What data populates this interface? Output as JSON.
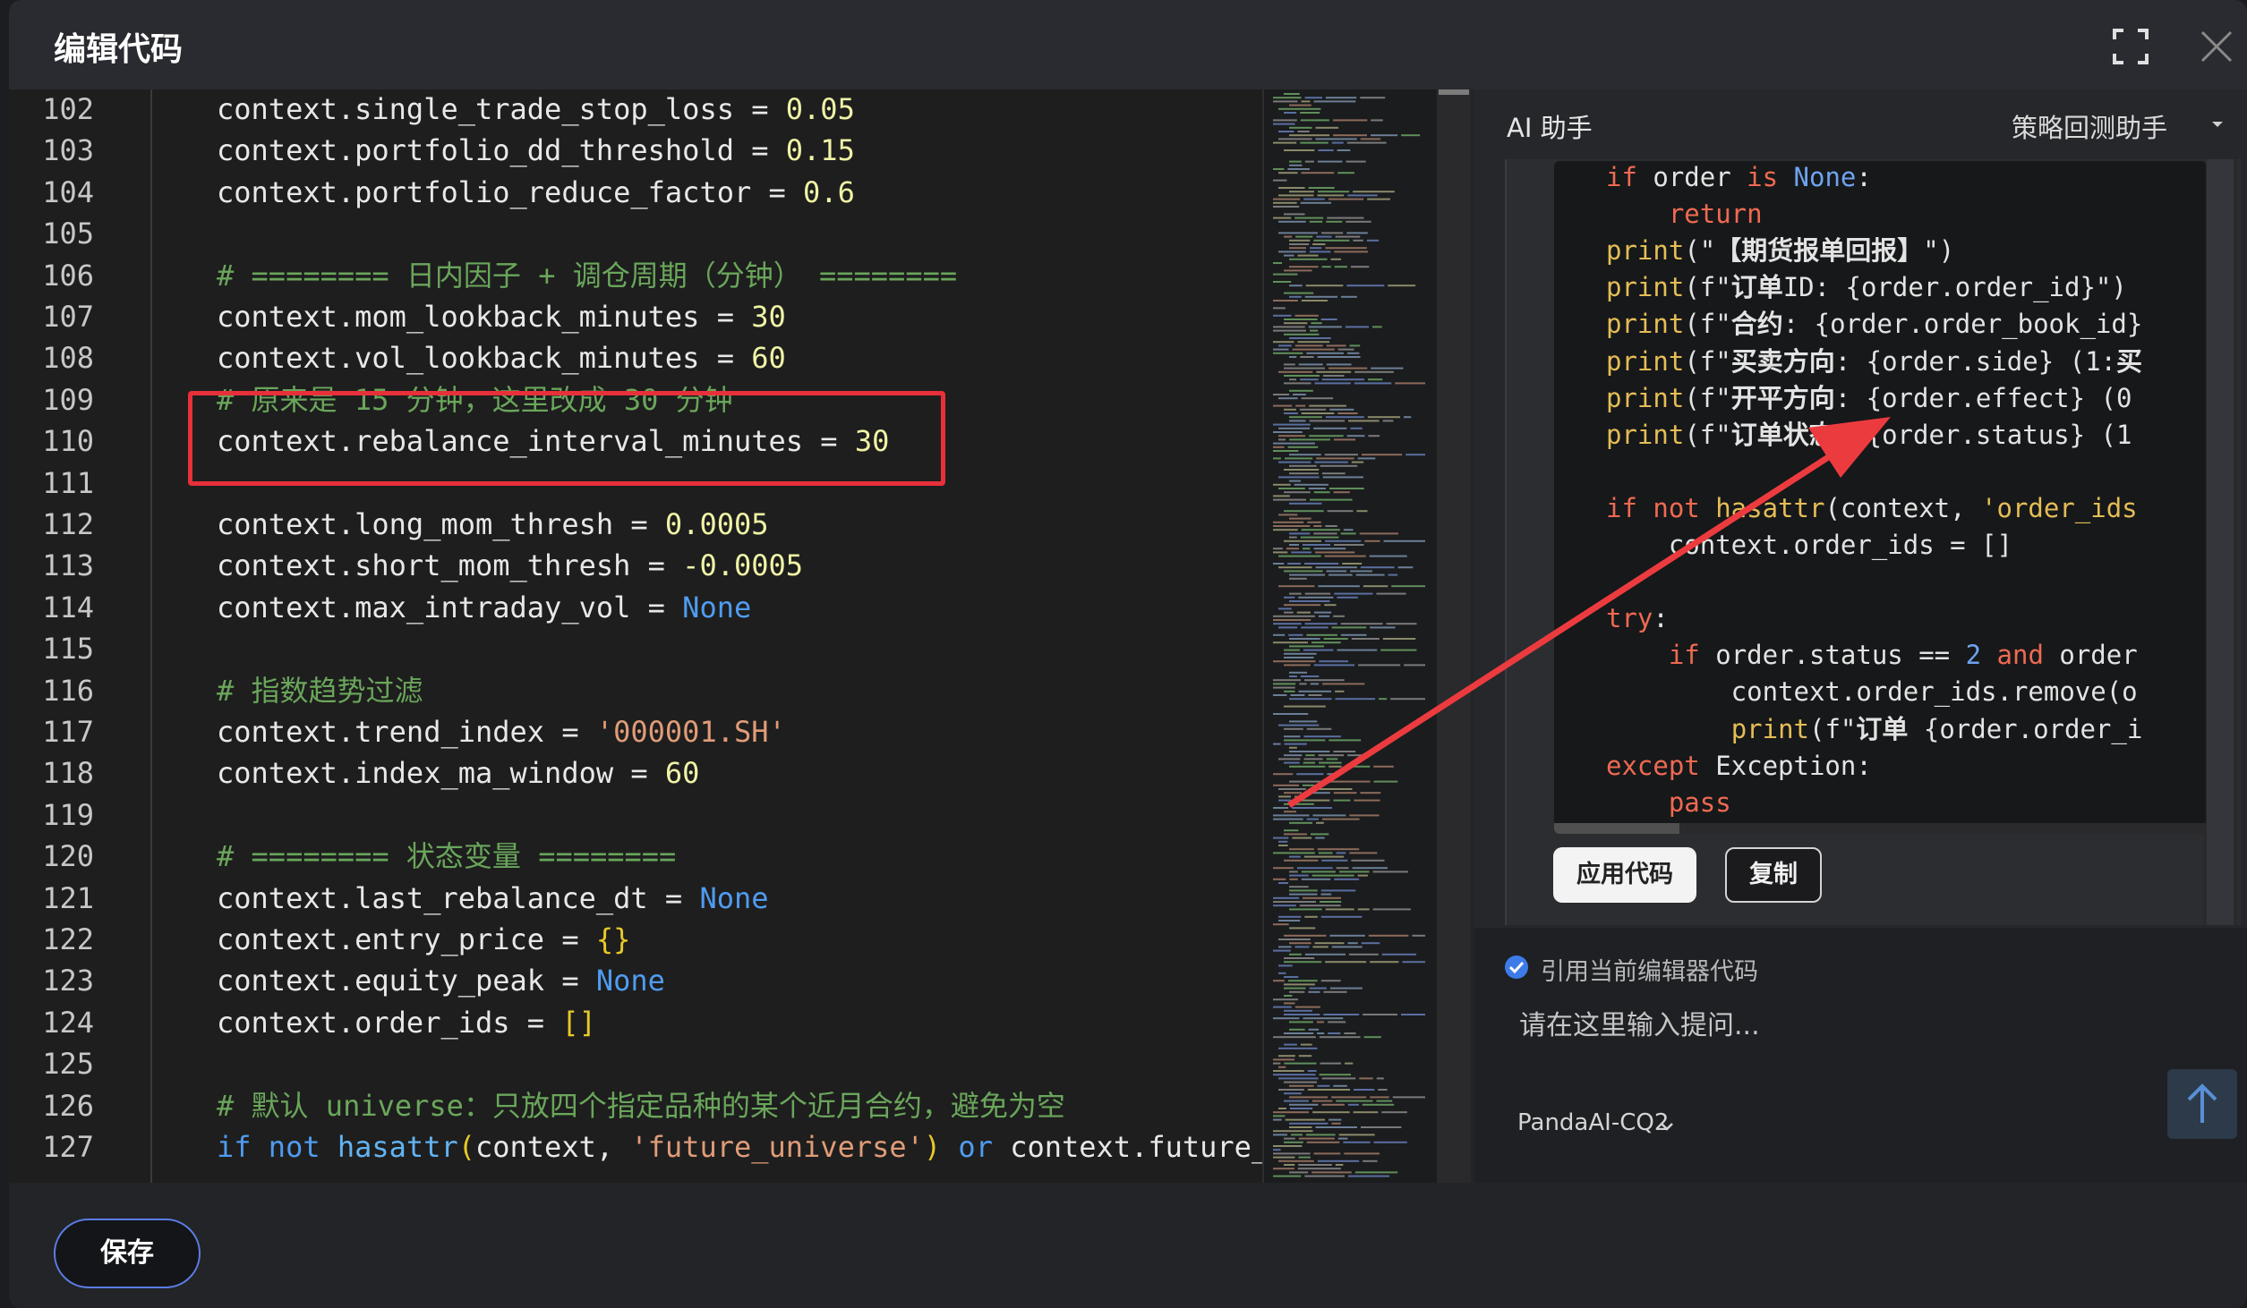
{
  "dialog": {
    "title": "编辑代码",
    "fullscreen_icon": "fullscreen-icon",
    "close_icon": "close-icon"
  },
  "editor": {
    "lines": [
      {
        "n": "102",
        "segs": [
          [
            "p",
            "context.single_trade_stop_loss = "
          ],
          [
            "num",
            "0.05"
          ]
        ]
      },
      {
        "n": "103",
        "segs": [
          [
            "p",
            "context.portfolio_dd_threshold = "
          ],
          [
            "num",
            "0.15"
          ]
        ]
      },
      {
        "n": "104",
        "segs": [
          [
            "p",
            "context.portfolio_reduce_factor = "
          ],
          [
            "num",
            "0.6"
          ]
        ]
      },
      {
        "n": "105",
        "segs": []
      },
      {
        "n": "106",
        "segs": [
          [
            "cmt",
            "# ======== 日内因子 + 调仓周期（分钟） ========"
          ]
        ]
      },
      {
        "n": "107",
        "segs": [
          [
            "p",
            "context.mom_lookback_minutes = "
          ],
          [
            "num",
            "30"
          ]
        ]
      },
      {
        "n": "108",
        "segs": [
          [
            "p",
            "context.vol_lookback_minutes = "
          ],
          [
            "num",
            "60"
          ]
        ]
      },
      {
        "n": "109",
        "segs": [
          [
            "cmt",
            "# 原来是 15 分钟，这里改成 30 分钟"
          ]
        ]
      },
      {
        "n": "110",
        "segs": [
          [
            "p",
            "context.rebalance_interval_minutes = "
          ],
          [
            "num",
            "30"
          ]
        ]
      },
      {
        "n": "111",
        "segs": []
      },
      {
        "n": "112",
        "segs": [
          [
            "p",
            "context.long_mom_thresh = "
          ],
          [
            "num",
            "0.0005"
          ]
        ]
      },
      {
        "n": "113",
        "segs": [
          [
            "p",
            "context.short_mom_thresh = "
          ],
          [
            "num",
            "-0.0005"
          ]
        ]
      },
      {
        "n": "114",
        "segs": [
          [
            "p",
            "context.max_intraday_vol = "
          ],
          [
            "kw",
            "None"
          ]
        ]
      },
      {
        "n": "115",
        "segs": []
      },
      {
        "n": "116",
        "segs": [
          [
            "cmt",
            "# 指数趋势过滤"
          ]
        ]
      },
      {
        "n": "117",
        "segs": [
          [
            "p",
            "context.trend_index = "
          ],
          [
            "str",
            "'000001.SH'"
          ]
        ]
      },
      {
        "n": "118",
        "segs": [
          [
            "p",
            "context.index_ma_window = "
          ],
          [
            "num",
            "60"
          ]
        ]
      },
      {
        "n": "119",
        "segs": []
      },
      {
        "n": "120",
        "segs": [
          [
            "cmt",
            "# ======== 状态变量 ========"
          ]
        ]
      },
      {
        "n": "121",
        "segs": [
          [
            "p",
            "context.last_rebalance_dt = "
          ],
          [
            "kw",
            "None"
          ]
        ]
      },
      {
        "n": "122",
        "segs": [
          [
            "p",
            "context.entry_price = "
          ],
          [
            "brace",
            "{}"
          ]
        ]
      },
      {
        "n": "123",
        "segs": [
          [
            "p",
            "context.equity_peak = "
          ],
          [
            "kw",
            "None"
          ]
        ]
      },
      {
        "n": "124",
        "segs": [
          [
            "p",
            "context.order_ids = "
          ],
          [
            "brace",
            "[]"
          ]
        ]
      },
      {
        "n": "125",
        "segs": []
      },
      {
        "n": "126",
        "segs": [
          [
            "cmt",
            "# 默认 universe：只放四个指定品种的某个近月合约，避免为空"
          ]
        ]
      },
      {
        "n": "127",
        "segs": [
          [
            "kw",
            "if not "
          ],
          [
            "fn",
            "hasattr"
          ],
          [
            "brace",
            "("
          ],
          [
            "p",
            "context, "
          ],
          [
            "str",
            "'future_universe'"
          ],
          [
            "brace",
            ")"
          ],
          [
            "kw",
            " or "
          ],
          [
            "p",
            "context.future_ur"
          ]
        ]
      }
    ]
  },
  "assistant": {
    "title": "AI 助手",
    "mode": "策略回测助手",
    "code_lines": [
      [
        [
          "kw",
          "if "
        ],
        [
          "p",
          "order "
        ],
        [
          "kw",
          "is "
        ],
        [
          "blue",
          "None"
        ],
        [
          "p",
          ":"
        ]
      ],
      [
        [
          "p",
          "    "
        ],
        [
          "kw",
          "return"
        ]
      ],
      [
        [
          "fn",
          "print"
        ],
        [
          "p",
          "(\""
        ],
        [
          "cn",
          "【期货报单回报】"
        ],
        [
          "p",
          "\")"
        ]
      ],
      [
        [
          "fn",
          "print"
        ],
        [
          "p",
          "(f\""
        ],
        [
          "cn",
          "订单"
        ],
        [
          "p",
          "ID: {order.order_id}\")"
        ]
      ],
      [
        [
          "fn",
          "print"
        ],
        [
          "p",
          "(f\""
        ],
        [
          "cn",
          "合约"
        ],
        [
          "p",
          ": {order.order_book_id}"
        ]
      ],
      [
        [
          "fn",
          "print"
        ],
        [
          "p",
          "(f\""
        ],
        [
          "cn",
          "买卖方向"
        ],
        [
          "p",
          ": {order.side} (1:"
        ],
        [
          "cn",
          "买"
        ]
      ],
      [
        [
          "fn",
          "print"
        ],
        [
          "p",
          "(f\""
        ],
        [
          "cn",
          "开平方向"
        ],
        [
          "p",
          ": {order.effect} (0"
        ]
      ],
      [
        [
          "fn",
          "print"
        ],
        [
          "p",
          "(f\""
        ],
        [
          "cn",
          "订单状态"
        ],
        [
          "p",
          ": {order.status} (1"
        ]
      ],
      [],
      [
        [
          "kw",
          "if not "
        ],
        [
          "fn",
          "hasattr"
        ],
        [
          "p",
          "(context, "
        ],
        [
          "fn",
          "'order_ids"
        ]
      ],
      [
        [
          "p",
          "    context.order_ids = []"
        ]
      ],
      [],
      [
        [
          "kw",
          "try"
        ],
        [
          "p",
          ":"
        ]
      ],
      [
        [
          "p",
          "    "
        ],
        [
          "kw",
          "if "
        ],
        [
          "p",
          "order.status == "
        ],
        [
          "blue",
          "2"
        ],
        [
          "kw",
          " and "
        ],
        [
          "p",
          "order"
        ]
      ],
      [
        [
          "p",
          "        context.order_ids.remove(o"
        ]
      ],
      [
        [
          "p",
          "        "
        ],
        [
          "fn",
          "print"
        ],
        [
          "p",
          "(f\""
        ],
        [
          "cn",
          "订单"
        ],
        [
          "p",
          " {order.order_i"
        ]
      ],
      [
        [
          "kw",
          "except "
        ],
        [
          "p",
          "Exception:"
        ]
      ],
      [
        [
          "p",
          "    "
        ],
        [
          "kw",
          "pass"
        ]
      ]
    ],
    "apply_label": "应用代码",
    "copy_label": "复制",
    "reference_label": "引用当前编辑器代码",
    "reference_checked": true,
    "input_placeholder": "请在这里输入提问...",
    "model": "PandaAI-CQ2"
  },
  "footer": {
    "save_label": "保存"
  },
  "colors": {
    "annotation_red": "#e8303a",
    "save_border": "#5b7de6",
    "check_blue": "#3d7be8"
  }
}
